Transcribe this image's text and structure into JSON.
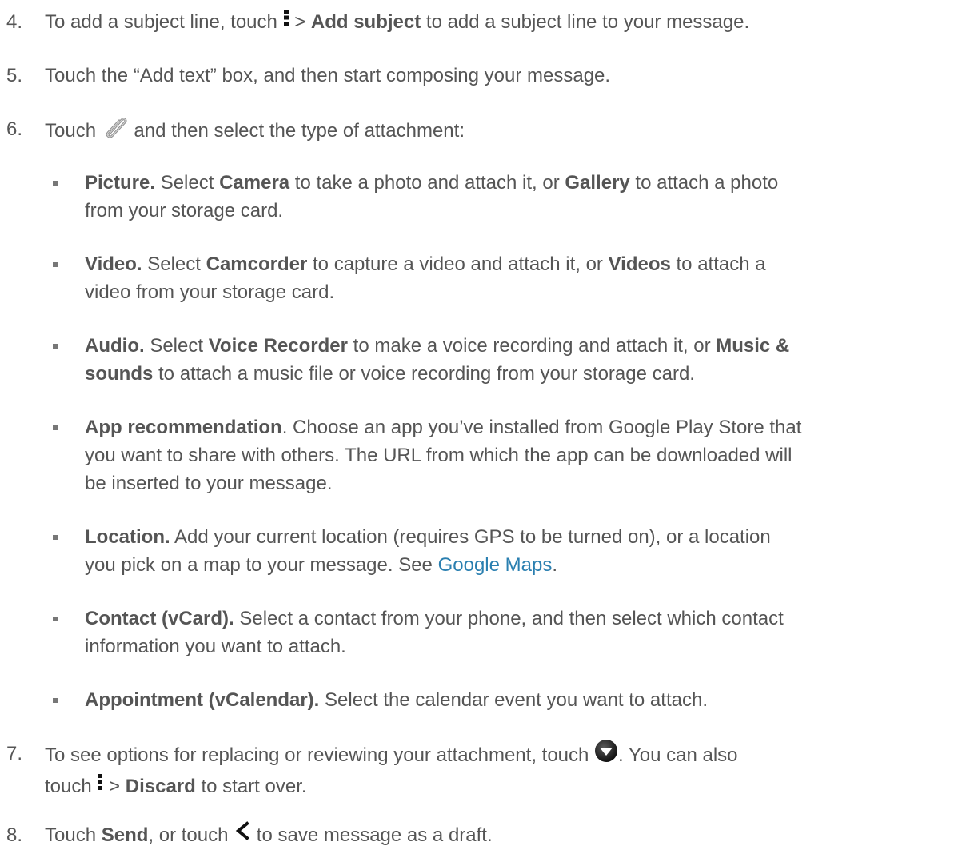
{
  "steps": [
    {
      "num": "4.",
      "pre": "To add a subject line, touch ",
      "sep": " > ",
      "bold": "Add subject",
      "post": " to add a subject line to your message.",
      "icon": "overflow-menu-icon"
    },
    {
      "num": "5.",
      "text": "Touch the “Add text” box, and then start composing your message."
    },
    {
      "num": "6.",
      "pre": "Touch ",
      "post": " and then select the type of attachment:",
      "icon": "paperclip-icon"
    },
    {
      "num": "7.",
      "line1_pre": "To see options for replacing or reviewing your attachment, touch ",
      "line1_post": ". You can also",
      "line2_pre": "touch ",
      "sep": " > ",
      "bold": "Discard",
      "line2_post": " to start over.",
      "icons": [
        "expand-circle-icon",
        "overflow-menu-icon"
      ]
    },
    {
      "num": "8.",
      "pre": "Touch ",
      "bold": "Send",
      "mid": ", or touch ",
      "post": " to save message as a draft.",
      "icon": "back-chevron-icon"
    }
  ],
  "bullets": [
    {
      "lines": [
        {
          "b1": "Picture.",
          "t1": " Select ",
          "b2": "Camera",
          "t2": " to take a photo and attach it, or ",
          "b3": "Gallery",
          "t3": " to attach a photo"
        },
        {
          "t1": "from your storage card."
        }
      ]
    },
    {
      "lines": [
        {
          "b1": "Video.",
          "t1": " Select ",
          "b2": "Camcorder",
          "t2": " to capture a video and attach it, or ",
          "b3": "Videos",
          "t3": " to attach a"
        },
        {
          "t1": "video from your storage card."
        }
      ]
    },
    {
      "lines": [
        {
          "b1": "Audio.",
          "t1": " Select ",
          "b2": "Voice Recorder",
          "t2": " to make a voice recording and attach it, or ",
          "b3": "Music &"
        },
        {
          "b1": "sounds",
          "t1": " to attach a music file or voice recording from your storage card."
        }
      ]
    },
    {
      "lines": [
        {
          "b1": "App recommendation",
          "t1": ". Choose an app you’ve installed from Google Play Store that"
        },
        {
          "t1": "you want to share with others. The URL from which the app can be downloaded will"
        },
        {
          "t1": "be inserted to your message."
        }
      ]
    },
    {
      "lines": [
        {
          "b1": "Location.",
          "t1": " Add your current location (requires GPS to be turned on), or a location"
        },
        {
          "t1": "you pick on a map to your message. See ",
          "link": "Google Maps",
          "t2": "."
        }
      ]
    },
    {
      "lines": [
        {
          "b1": "Contact (vCard).",
          "t1": " Select a contact from your phone, and then select which contact"
        },
        {
          "t1": "information you want to attach."
        }
      ]
    },
    {
      "lines": [
        {
          "b1": "Appointment (vCalendar).",
          "t1": " Select the calendar event you want to attach."
        }
      ]
    }
  ]
}
